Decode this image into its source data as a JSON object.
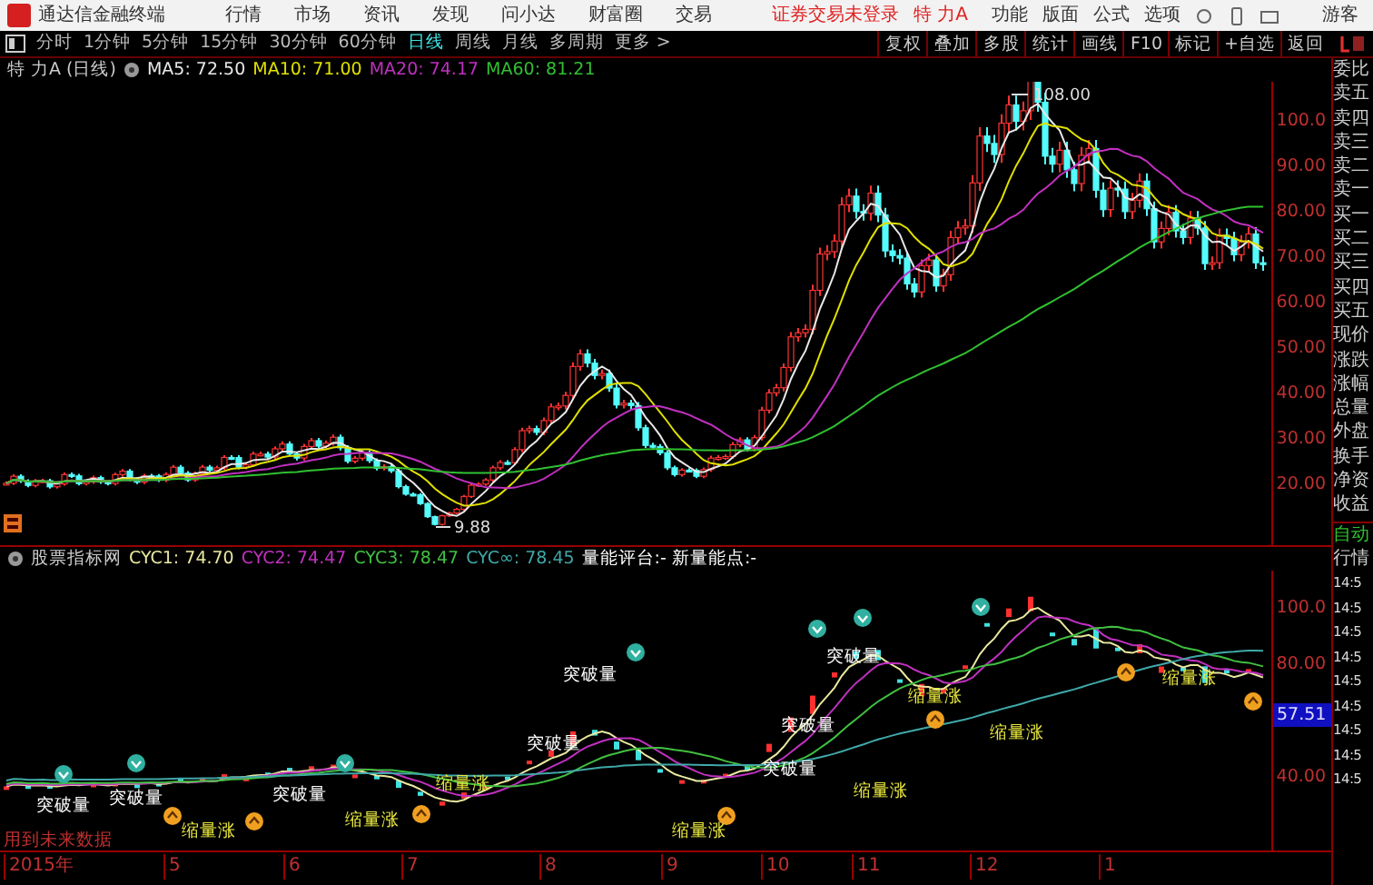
{
  "app_bar": {
    "logo_text": "通达信金融终端",
    "menu": [
      "行情",
      "市场",
      "资讯",
      "发现",
      "问小达",
      "财富圈",
      "交易"
    ],
    "login_status": "证券交易未登录",
    "stock": "特 力A",
    "right_menu": [
      "功能",
      "版面",
      "公式",
      "选项"
    ],
    "user": "游客"
  },
  "period_bar": {
    "periods": [
      {
        "label": "分时",
        "selected": false
      },
      {
        "label": "1分钟",
        "selected": false
      },
      {
        "label": "5分钟",
        "selected": false
      },
      {
        "label": "15分钟",
        "selected": false
      },
      {
        "label": "30分钟",
        "selected": false
      },
      {
        "label": "60分钟",
        "selected": false
      },
      {
        "label": "日线",
        "selected": true
      },
      {
        "label": "周线",
        "selected": false
      },
      {
        "label": "月线",
        "selected": false
      },
      {
        "label": "多周期",
        "selected": false
      },
      {
        "label": "更多 >",
        "selected": false
      }
    ],
    "tools": [
      "复权",
      "叠加",
      "多股",
      "统计",
      "画线",
      "F10",
      "标记",
      "+自选",
      "返回"
    ]
  },
  "main_chart": {
    "title": "特 力A (日线)",
    "ma": [
      {
        "label": "MA5: 72.50",
        "color": "#e8e8e8"
      },
      {
        "label": "MA10: 71.00",
        "color": "#e0e000"
      },
      {
        "label": "MA20: 74.17",
        "color": "#c030c0"
      },
      {
        "label": "MA60: 81.21",
        "color": "#30c030"
      }
    ],
    "high_label": "108.00",
    "low_label": "9.88",
    "y_labels": [
      "100.0",
      "90.00",
      "80.00",
      "70.00",
      "60.00",
      "50.00",
      "40.00",
      "30.00",
      "20.00"
    ]
  },
  "indicator": {
    "name": "股票指标网",
    "lines": [
      {
        "label": "CYC1: 74.70",
        "color": "#e8e8a0"
      },
      {
        "label": "CYC2: 74.47",
        "color": "#c030c0"
      },
      {
        "label": "CYC3: 78.47",
        "color": "#40c040"
      },
      {
        "label": "CYC∞: 78.45",
        "color": "#40a8a8"
      }
    ],
    "extra": "量能评台:-  新量能点:-",
    "note": "用到未来数据",
    "y_labels": [
      "100.0",
      "80.00",
      "40.00"
    ],
    "current_value": "57.51",
    "signals": [
      {
        "text": "突破量",
        "kind": "breakout"
      },
      {
        "text": "突破量",
        "kind": "breakout"
      },
      {
        "text": "缩量涨",
        "kind": "shrink"
      },
      {
        "text": "突破量",
        "kind": "breakout"
      },
      {
        "text": "缩量涨",
        "kind": "shrink"
      },
      {
        "text": "缩量涨",
        "kind": "shrink"
      },
      {
        "text": "突破量",
        "kind": "breakout"
      },
      {
        "text": "突破量",
        "kind": "breakout"
      },
      {
        "text": "缩量涨",
        "kind": "shrink"
      },
      {
        "text": "突破量",
        "kind": "breakout"
      },
      {
        "text": "突破量",
        "kind": "breakout"
      },
      {
        "text": "缩量涨",
        "kind": "shrink"
      },
      {
        "text": "突破量",
        "kind": "breakout"
      },
      {
        "text": "缩量涨",
        "kind": "shrink"
      },
      {
        "text": "缩量涨",
        "kind": "shrink"
      },
      {
        "text": "缩量涨",
        "kind": "shrink"
      }
    ]
  },
  "x_axis": [
    "2015年",
    "5",
    "6",
    "7",
    "8",
    "9",
    "10",
    "11",
    "12",
    "1"
  ],
  "quote_panel": {
    "fields": [
      "委比",
      "卖五",
      "卖四",
      "卖三",
      "卖二",
      "卖一",
      "买一",
      "买二",
      "买三",
      "买四",
      "买五",
      "现价",
      "涨跌",
      "涨幅",
      "总量",
      "外盘",
      "换手",
      "净资",
      "收益"
    ],
    "mode": "自动",
    "tab": "行情",
    "times": [
      "14:5",
      "14:5",
      "14:5",
      "14:5",
      "14:5",
      "14:5",
      "14:5",
      "14:5",
      "14:5"
    ]
  }
}
